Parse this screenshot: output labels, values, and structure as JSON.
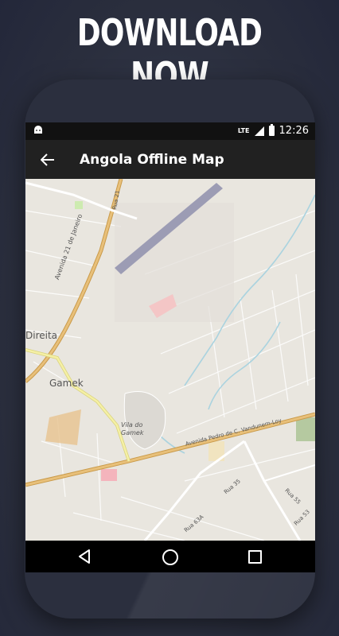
{
  "promo": {
    "headline": "DOWNLOAD NOW"
  },
  "status_bar": {
    "network": "LTE",
    "time": "12:26",
    "notification_icon": "android-icon"
  },
  "app_bar": {
    "title": "Angola Offline Map",
    "back_icon": "arrow-back-icon"
  },
  "map": {
    "labels": {
      "direita": "Direita",
      "gamek": "Gamek",
      "vila_do_gamek": "Vila do Gamek",
      "avenida_21_janeiro": "Avenida 21 de Janeiro",
      "rua_21": "Rua 21",
      "avenida_pedro": "Avenida Pedro de C. Vandunem-Loy",
      "rua_35": "Rua 35",
      "rua_63a": "Rua 63A",
      "rua_55": "Rua 55",
      "rua_53": "Rua 53"
    },
    "colors": {
      "land": "#e9e6df",
      "major_road": "#e8c07a",
      "secondary_road": "#f5f0a5",
      "water": "#aad3df",
      "runway": "#9c9cb4"
    }
  },
  "nav_bar": {
    "back": "nav-back-icon",
    "home": "nav-home-icon",
    "recents": "nav-recents-icon"
  }
}
